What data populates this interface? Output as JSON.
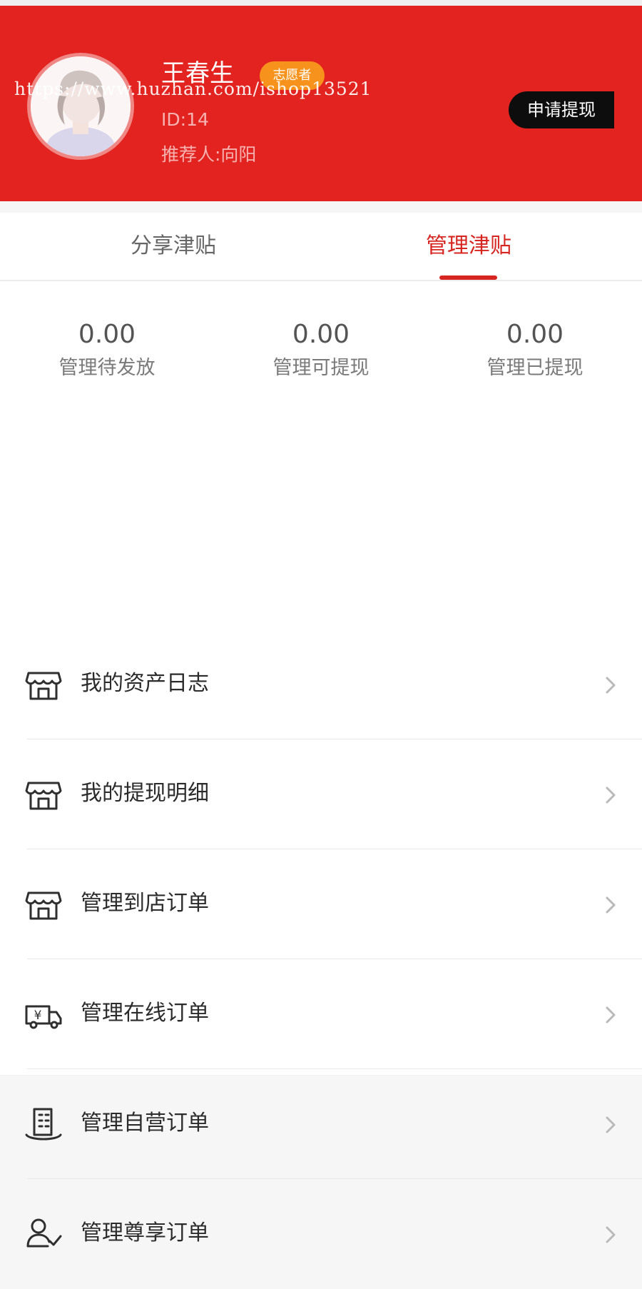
{
  "header": {
    "user_name": "王春生",
    "role_badge": "志愿者",
    "watermark": "https://www.huzhan.com/ishop13521",
    "user_id": "ID:14",
    "referrer": "推荐人:向阳",
    "withdraw_button": "申请提现",
    "colors": {
      "background": "#e3231f",
      "badge": "#f7931c",
      "button": "#0e0d0d"
    },
    "avatar_icon": "default-avatar-icon"
  },
  "tabs": {
    "items": [
      {
        "label": "分享津贴",
        "active": false
      },
      {
        "label": "管理津贴",
        "active": true
      }
    ],
    "active_color": "#d72621"
  },
  "stats": [
    {
      "value": "0.00",
      "label": "管理待发放"
    },
    {
      "value": "0.00",
      "label": "管理可提现"
    },
    {
      "value": "0.00",
      "label": "管理已提现"
    }
  ],
  "menu": {
    "items": [
      {
        "label": "我的资产日志",
        "icon": "store-icon"
      },
      {
        "label": "我的提现明细",
        "icon": "store-icon"
      },
      {
        "label": "管理到店订单",
        "icon": "store-icon"
      },
      {
        "label": "管理在线订单",
        "icon": "truck-icon"
      },
      {
        "label": "管理自营订单",
        "icon": "building-icon"
      },
      {
        "label": "管理尊享订单",
        "icon": "user-check-icon"
      }
    ],
    "chevron_icon": "chevron-right-icon"
  }
}
